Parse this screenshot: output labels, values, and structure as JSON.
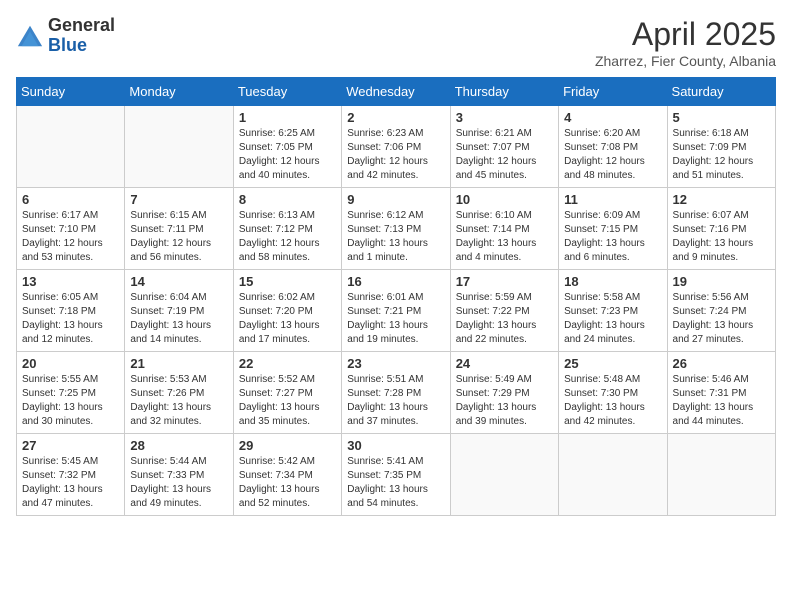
{
  "header": {
    "logo_general": "General",
    "logo_blue": "Blue",
    "month": "April 2025",
    "location": "Zharrez, Fier County, Albania"
  },
  "days_of_week": [
    "Sunday",
    "Monday",
    "Tuesday",
    "Wednesday",
    "Thursday",
    "Friday",
    "Saturday"
  ],
  "weeks": [
    [
      {
        "day": "",
        "info": ""
      },
      {
        "day": "",
        "info": ""
      },
      {
        "day": "1",
        "sunrise": "Sunrise: 6:25 AM",
        "sunset": "Sunset: 7:05 PM",
        "daylight": "Daylight: 12 hours and 40 minutes."
      },
      {
        "day": "2",
        "sunrise": "Sunrise: 6:23 AM",
        "sunset": "Sunset: 7:06 PM",
        "daylight": "Daylight: 12 hours and 42 minutes."
      },
      {
        "day": "3",
        "sunrise": "Sunrise: 6:21 AM",
        "sunset": "Sunset: 7:07 PM",
        "daylight": "Daylight: 12 hours and 45 minutes."
      },
      {
        "day": "4",
        "sunrise": "Sunrise: 6:20 AM",
        "sunset": "Sunset: 7:08 PM",
        "daylight": "Daylight: 12 hours and 48 minutes."
      },
      {
        "day": "5",
        "sunrise": "Sunrise: 6:18 AM",
        "sunset": "Sunset: 7:09 PM",
        "daylight": "Daylight: 12 hours and 51 minutes."
      }
    ],
    [
      {
        "day": "6",
        "sunrise": "Sunrise: 6:17 AM",
        "sunset": "Sunset: 7:10 PM",
        "daylight": "Daylight: 12 hours and 53 minutes."
      },
      {
        "day": "7",
        "sunrise": "Sunrise: 6:15 AM",
        "sunset": "Sunset: 7:11 PM",
        "daylight": "Daylight: 12 hours and 56 minutes."
      },
      {
        "day": "8",
        "sunrise": "Sunrise: 6:13 AM",
        "sunset": "Sunset: 7:12 PM",
        "daylight": "Daylight: 12 hours and 58 minutes."
      },
      {
        "day": "9",
        "sunrise": "Sunrise: 6:12 AM",
        "sunset": "Sunset: 7:13 PM",
        "daylight": "Daylight: 13 hours and 1 minute."
      },
      {
        "day": "10",
        "sunrise": "Sunrise: 6:10 AM",
        "sunset": "Sunset: 7:14 PM",
        "daylight": "Daylight: 13 hours and 4 minutes."
      },
      {
        "day": "11",
        "sunrise": "Sunrise: 6:09 AM",
        "sunset": "Sunset: 7:15 PM",
        "daylight": "Daylight: 13 hours and 6 minutes."
      },
      {
        "day": "12",
        "sunrise": "Sunrise: 6:07 AM",
        "sunset": "Sunset: 7:16 PM",
        "daylight": "Daylight: 13 hours and 9 minutes."
      }
    ],
    [
      {
        "day": "13",
        "sunrise": "Sunrise: 6:05 AM",
        "sunset": "Sunset: 7:18 PM",
        "daylight": "Daylight: 13 hours and 12 minutes."
      },
      {
        "day": "14",
        "sunrise": "Sunrise: 6:04 AM",
        "sunset": "Sunset: 7:19 PM",
        "daylight": "Daylight: 13 hours and 14 minutes."
      },
      {
        "day": "15",
        "sunrise": "Sunrise: 6:02 AM",
        "sunset": "Sunset: 7:20 PM",
        "daylight": "Daylight: 13 hours and 17 minutes."
      },
      {
        "day": "16",
        "sunrise": "Sunrise: 6:01 AM",
        "sunset": "Sunset: 7:21 PM",
        "daylight": "Daylight: 13 hours and 19 minutes."
      },
      {
        "day": "17",
        "sunrise": "Sunrise: 5:59 AM",
        "sunset": "Sunset: 7:22 PM",
        "daylight": "Daylight: 13 hours and 22 minutes."
      },
      {
        "day": "18",
        "sunrise": "Sunrise: 5:58 AM",
        "sunset": "Sunset: 7:23 PM",
        "daylight": "Daylight: 13 hours and 24 minutes."
      },
      {
        "day": "19",
        "sunrise": "Sunrise: 5:56 AM",
        "sunset": "Sunset: 7:24 PM",
        "daylight": "Daylight: 13 hours and 27 minutes."
      }
    ],
    [
      {
        "day": "20",
        "sunrise": "Sunrise: 5:55 AM",
        "sunset": "Sunset: 7:25 PM",
        "daylight": "Daylight: 13 hours and 30 minutes."
      },
      {
        "day": "21",
        "sunrise": "Sunrise: 5:53 AM",
        "sunset": "Sunset: 7:26 PM",
        "daylight": "Daylight: 13 hours and 32 minutes."
      },
      {
        "day": "22",
        "sunrise": "Sunrise: 5:52 AM",
        "sunset": "Sunset: 7:27 PM",
        "daylight": "Daylight: 13 hours and 35 minutes."
      },
      {
        "day": "23",
        "sunrise": "Sunrise: 5:51 AM",
        "sunset": "Sunset: 7:28 PM",
        "daylight": "Daylight: 13 hours and 37 minutes."
      },
      {
        "day": "24",
        "sunrise": "Sunrise: 5:49 AM",
        "sunset": "Sunset: 7:29 PM",
        "daylight": "Daylight: 13 hours and 39 minutes."
      },
      {
        "day": "25",
        "sunrise": "Sunrise: 5:48 AM",
        "sunset": "Sunset: 7:30 PM",
        "daylight": "Daylight: 13 hours and 42 minutes."
      },
      {
        "day": "26",
        "sunrise": "Sunrise: 5:46 AM",
        "sunset": "Sunset: 7:31 PM",
        "daylight": "Daylight: 13 hours and 44 minutes."
      }
    ],
    [
      {
        "day": "27",
        "sunrise": "Sunrise: 5:45 AM",
        "sunset": "Sunset: 7:32 PM",
        "daylight": "Daylight: 13 hours and 47 minutes."
      },
      {
        "day": "28",
        "sunrise": "Sunrise: 5:44 AM",
        "sunset": "Sunset: 7:33 PM",
        "daylight": "Daylight: 13 hours and 49 minutes."
      },
      {
        "day": "29",
        "sunrise": "Sunrise: 5:42 AM",
        "sunset": "Sunset: 7:34 PM",
        "daylight": "Daylight: 13 hours and 52 minutes."
      },
      {
        "day": "30",
        "sunrise": "Sunrise: 5:41 AM",
        "sunset": "Sunset: 7:35 PM",
        "daylight": "Daylight: 13 hours and 54 minutes."
      },
      {
        "day": "",
        "info": ""
      },
      {
        "day": "",
        "info": ""
      },
      {
        "day": "",
        "info": ""
      }
    ]
  ]
}
